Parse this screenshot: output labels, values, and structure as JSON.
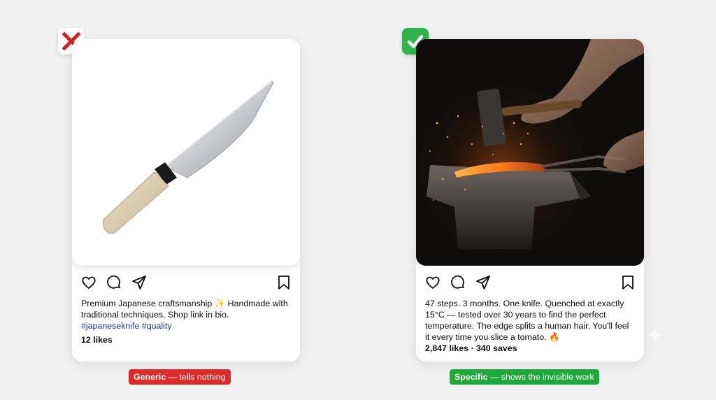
{
  "left_post": {
    "caption_text": "Premium Japanese craftsmanship ✨ Handmade with traditional techniques. Shop link in bio.",
    "hashtags": "#japaneseknife #quality",
    "likes": "12 likes",
    "badge_icon": "red-x-icon",
    "label_bold": "Generic",
    "label_rest": " — tells nothing",
    "label_color": "#dc2b2b"
  },
  "right_post": {
    "caption_text": "47 steps. 3 months. One knife. Quenched at exactly 15°C — tested over 30 years to find the perfect temperature. The edge splits a human hair. You'll feel it every time you slice a tomato. 🔥",
    "likes": "2,847 likes · 340 saves",
    "badge_icon": "green-check-icon",
    "label_bold": "Specific",
    "label_rest": " — shows the invisible work",
    "label_color": "#1fa83a"
  },
  "icons": {
    "actions": [
      "heart-icon",
      "comment-icon",
      "share-icon",
      "bookmark-icon"
    ]
  },
  "colors": {
    "background": "#f1f1f2",
    "hashtag": "#1f3a8a"
  }
}
